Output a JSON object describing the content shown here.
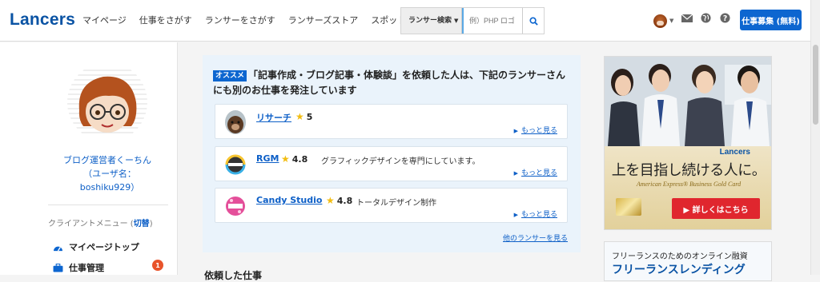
{
  "header": {
    "logo": "Lancers",
    "nav": [
      "マイページ",
      "仕事をさがす",
      "ランサーをさがす",
      "ランサーズストア",
      "スポット常駐"
    ],
    "search": {
      "type_label": "ランサー検索",
      "placeholder": "例）PHP ロゴ"
    },
    "post_job_button": "仕事募集 (無料)"
  },
  "sidebar": {
    "display_name": "ブログ運営者くーちん",
    "username": "（ユーザ名：boshiku929）",
    "menu_title": "クライアントメニュー (",
    "menu_switch": "切替",
    "menu_title_end": ")",
    "items": [
      {
        "label": "マイページトップ",
        "icon": "dashboard-icon"
      },
      {
        "label": "仕事管理",
        "icon": "briefcase-icon",
        "badge": "1"
      }
    ]
  },
  "recommend": {
    "tag": "オススメ",
    "heading": "「記事作成・ブログ記事・体験談」を依頼した人は、下記のランサーさんにも別のお仕事を発注しています",
    "lancers": [
      {
        "name": "リサーチ",
        "rating": "5",
        "description": "",
        "more": "もっと見る"
      },
      {
        "name": "RGM",
        "rating": "4.8",
        "description": "グラフィックデザインを専門にしています。",
        "more": "もっと見る"
      },
      {
        "name": "Candy Studio",
        "rating": "4.8",
        "description": "トータルデザイン制作",
        "more": "もっと見る"
      }
    ],
    "other_link": "他のランサーを見る"
  },
  "below_title": "依頼した仕事",
  "ads": {
    "brand": "Lancers",
    "headline": "上を目指し続ける人に。",
    "subline": "American Express® Business Gold Card",
    "cta": "▶ 詳しくはこちら",
    "ad2_line1": "フリーランスのためのオンライン融資",
    "ad2_line2": "フリーランスレンディング"
  },
  "colors": {
    "brand_blue": "#0d66d0",
    "link": "#0d5fc7",
    "badge": "#e8542b",
    "cta_red": "#e0262e"
  }
}
